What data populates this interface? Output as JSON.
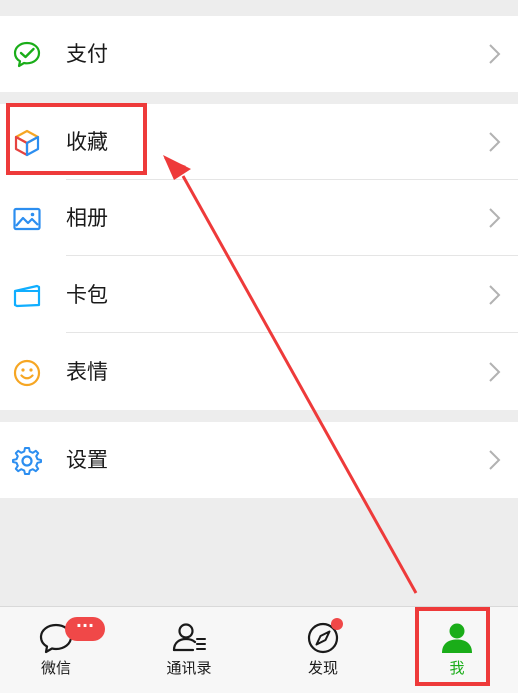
{
  "menu": {
    "pay": {
      "label": "支付",
      "icon": "wallet-check-icon"
    },
    "favorites": {
      "label": "收藏",
      "icon": "cube-icon"
    },
    "album": {
      "label": "相册",
      "icon": "photo-icon"
    },
    "cards": {
      "label": "卡包",
      "icon": "card-icon"
    },
    "stickers": {
      "label": "表情",
      "icon": "smiley-icon"
    },
    "settings": {
      "label": "设置",
      "icon": "gear-icon"
    }
  },
  "tabbar": {
    "tabs": [
      {
        "label": "微信",
        "icon": "chat-bubble-icon",
        "badge": "···"
      },
      {
        "label": "通讯录",
        "icon": "contacts-icon"
      },
      {
        "label": "发现",
        "icon": "compass-icon"
      },
      {
        "label": "我",
        "icon": "person-icon",
        "active": true
      }
    ]
  },
  "colors": {
    "accent_green": "#1aad19",
    "badge_red": "#f04848",
    "annotation_red": "#ee3a3a",
    "background": "#ededed"
  }
}
